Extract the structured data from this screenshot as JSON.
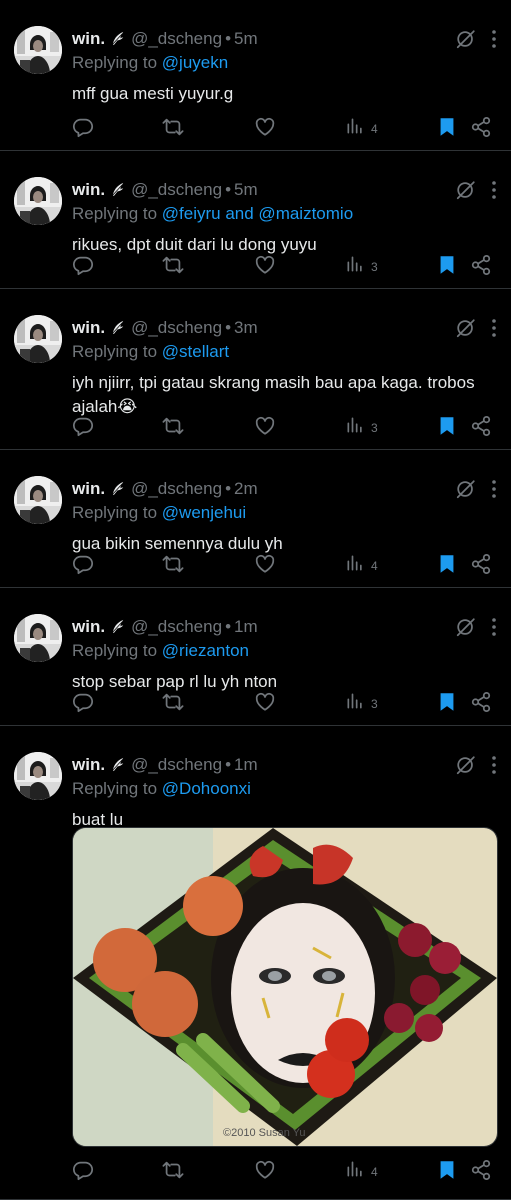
{
  "tweets": [
    {
      "name": "win.",
      "handle": "@_dscheng",
      "time": "5m",
      "replying_to": "Replying to",
      "mentions": "@juyekn",
      "text": "mff gua mesti yuyur.g",
      "views": "4"
    },
    {
      "name": "win.",
      "handle": "@_dscheng",
      "time": "5m",
      "replying_to": "Replying to",
      "mentions": "@feiyru and @maiztomio",
      "text": "rikues, dpt duit dari lu dong yuyu",
      "views": "3"
    },
    {
      "name": "win.",
      "handle": "@_dscheng",
      "time": "3m",
      "replying_to": "Replying to",
      "mentions": "@stellart",
      "text": "iyh njiirr, tpi gatau skrang masih bau apa kaga. trobos ajalah😭",
      "views": "3"
    },
    {
      "name": "win.",
      "handle": "@_dscheng",
      "time": "2m",
      "replying_to": "Replying to",
      "mentions": "@wenjehui",
      "text": "gua bikin semennya dulu yh",
      "views": "4"
    },
    {
      "name": "win.",
      "handle": "@_dscheng",
      "time": "1m",
      "replying_to": "Replying to",
      "mentions": "@riezanton",
      "text": "stop sebar pap rl lu yh nton",
      "views": "3"
    },
    {
      "name": "win.",
      "handle": "@_dscheng",
      "time": "1m",
      "replying_to": "Replying to",
      "mentions": "@Dohoonxi",
      "text": "buat lu",
      "views": "4"
    }
  ],
  "separator": "•",
  "media_watermark": "©2010 Susan Yu",
  "icons": {
    "reply": "reply-icon",
    "retweet": "retweet-icon",
    "like": "heart-icon",
    "views": "views-icon",
    "bookmark": "bookmark-icon",
    "share": "share-icon",
    "grok": "grok-icon",
    "more": "more-icon",
    "badge": "feather-badge-icon"
  },
  "colors": {
    "background": "#000000",
    "accent": "#1d9bf0",
    "muted": "#71767b",
    "text": "#e7e9ea"
  }
}
